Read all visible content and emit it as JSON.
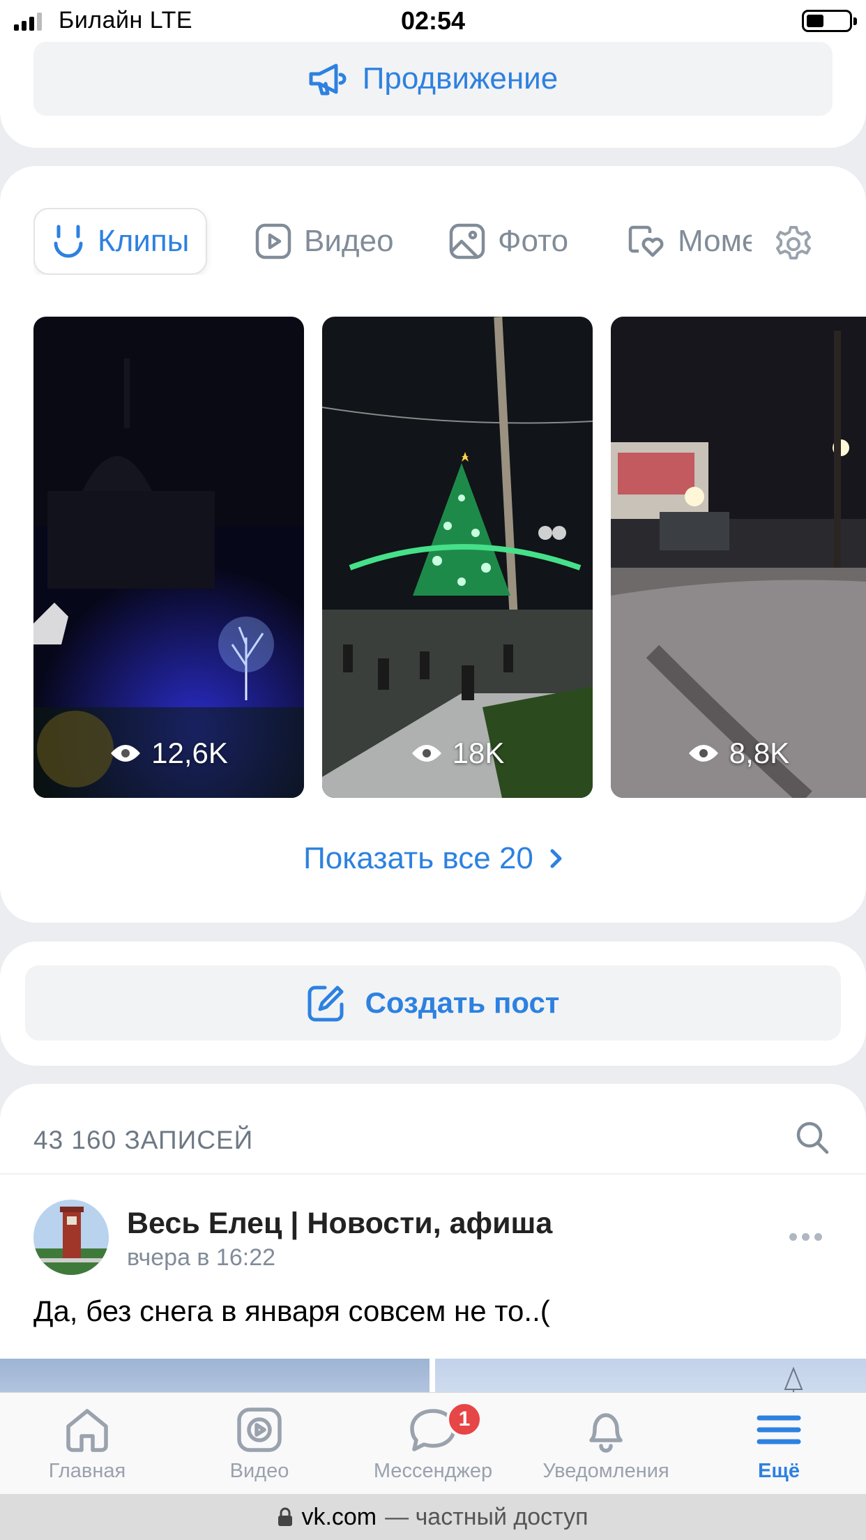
{
  "status_bar": {
    "carrier": "Билайн  LTE",
    "time": "02:54"
  },
  "promo": {
    "label": "Продвижение"
  },
  "media_tabs": [
    {
      "label": "Клипы",
      "icon": "clips-icon",
      "active": true
    },
    {
      "label": "Видео",
      "icon": "video-icon",
      "active": false
    },
    {
      "label": "Фото",
      "icon": "photo-icon",
      "active": false
    },
    {
      "label": "Моме",
      "icon": "moments-icon",
      "active": false
    }
  ],
  "clips": [
    {
      "views": "12,6K"
    },
    {
      "views": "18K"
    },
    {
      "views": "8,8K"
    }
  ],
  "show_all": {
    "label": "Показать все 20"
  },
  "create_post": {
    "label": "Создать пост"
  },
  "feed": {
    "records_count": "43 160 ЗАПИСЕЙ",
    "post": {
      "author": "Весь Елец | Новости, афиша",
      "time": "вчера в 16:22",
      "text": "Да, без снега в января совсем не то..("
    }
  },
  "bottom_nav": [
    {
      "label": "Главная",
      "icon": "home-icon",
      "active": false
    },
    {
      "label": "Видео",
      "icon": "video-nav-icon",
      "active": false
    },
    {
      "label": "Мессенджер",
      "icon": "messenger-icon",
      "active": false,
      "badge": "1"
    },
    {
      "label": "Уведомления",
      "icon": "bell-icon",
      "active": false
    },
    {
      "label": "Ещё",
      "icon": "menu-icon",
      "active": true
    }
  ],
  "url_bar": {
    "domain": "vk.com",
    "suffix": "— частный доступ"
  },
  "colors": {
    "accent": "#2d81e0",
    "background": "#ebedf0",
    "badge": "#e64646"
  }
}
